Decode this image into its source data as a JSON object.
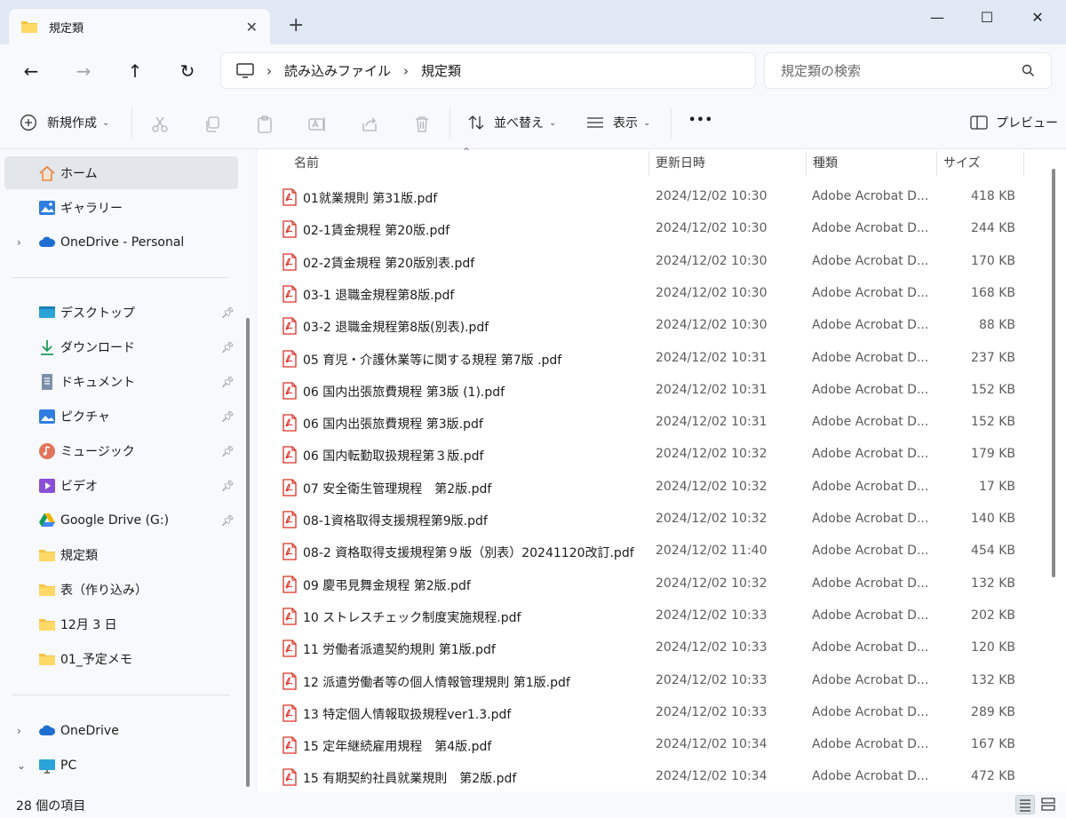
{
  "window": {
    "tab_title": "規定類",
    "close_tab": "✕",
    "new_tab": "+",
    "minimize": "—",
    "maximize": "☐",
    "close": "✕"
  },
  "nav": {
    "back": "←",
    "forward": "→",
    "up": "↑",
    "refresh": "↻",
    "breadcrumb": [
      "読み込みファイル",
      "規定類"
    ],
    "search_placeholder": "規定類の検索"
  },
  "toolbar": {
    "new_label": "新規作成",
    "sort_label": "並べ替え",
    "view_label": "表示",
    "more_label": "•••",
    "preview_label": "プレビュー"
  },
  "sidebar": {
    "top": [
      {
        "label": "ホーム",
        "icon": "home-icon",
        "selected": true
      },
      {
        "label": "ギャラリー",
        "icon": "gallery-icon"
      },
      {
        "label": "OneDrive - Personal",
        "icon": "cloud-icon",
        "expandable": true
      }
    ],
    "quick": [
      {
        "label": "デスクトップ",
        "icon": "desktop-icon",
        "pinned": true
      },
      {
        "label": "ダウンロード",
        "icon": "download-icon",
        "pinned": true
      },
      {
        "label": "ドキュメント",
        "icon": "document-icon",
        "pinned": true
      },
      {
        "label": "ピクチャ",
        "icon": "pictures-icon",
        "pinned": true
      },
      {
        "label": "ミュージック",
        "icon": "music-icon",
        "pinned": true
      },
      {
        "label": "ビデオ",
        "icon": "video-icon",
        "pinned": true
      },
      {
        "label": "Google Drive (G:)",
        "icon": "google-drive-icon",
        "pinned": true
      },
      {
        "label": "規定類",
        "icon": "folder-icon"
      },
      {
        "label": "表（作り込み）",
        "icon": "folder-icon"
      },
      {
        "label": "12月 3 日",
        "icon": "folder-icon"
      },
      {
        "label": "01_予定メモ",
        "icon": "folder-icon"
      }
    ],
    "bottom": [
      {
        "label": "OneDrive",
        "icon": "cloud-icon",
        "chevron": "›"
      },
      {
        "label": "PC",
        "icon": "pc-icon",
        "chevron": "⌄"
      }
    ]
  },
  "columns": {
    "name": "名前",
    "date": "更新日時",
    "type": "種類",
    "size": "サイズ"
  },
  "files": [
    {
      "name": "01就業規則 第31版.pdf",
      "date": "2024/12/02 10:30",
      "type": "Adobe Acrobat D...",
      "size": "418 KB"
    },
    {
      "name": "02-1賃金規程 第20版.pdf",
      "date": "2024/12/02 10:30",
      "type": "Adobe Acrobat D...",
      "size": "244 KB"
    },
    {
      "name": "02-2賃金規程 第20版別表.pdf",
      "date": "2024/12/02 10:30",
      "type": "Adobe Acrobat D...",
      "size": "170 KB"
    },
    {
      "name": "03-1 退職金規程第8版.pdf",
      "date": "2024/12/02 10:30",
      "type": "Adobe Acrobat D...",
      "size": "168 KB"
    },
    {
      "name": "03-2 退職金規程第8版(別表).pdf",
      "date": "2024/12/02 10:30",
      "type": "Adobe Acrobat D...",
      "size": "88 KB"
    },
    {
      "name": "05 育児・介護休業等に関する規程 第7版 .pdf",
      "date": "2024/12/02 10:31",
      "type": "Adobe Acrobat D...",
      "size": "237 KB"
    },
    {
      "name": "06 国内出張旅費規程 第3版 (1).pdf",
      "date": "2024/12/02 10:31",
      "type": "Adobe Acrobat D...",
      "size": "152 KB"
    },
    {
      "name": "06 国内出張旅費規程 第3版.pdf",
      "date": "2024/12/02 10:31",
      "type": "Adobe Acrobat D...",
      "size": "152 KB"
    },
    {
      "name": "06 国内転勤取扱規程第３版.pdf",
      "date": "2024/12/02 10:32",
      "type": "Adobe Acrobat D...",
      "size": "179 KB"
    },
    {
      "name": "07 安全衛生管理規程　第2版.pdf",
      "date": "2024/12/02 10:32",
      "type": "Adobe Acrobat D...",
      "size": "17 KB"
    },
    {
      "name": "08-1資格取得支援規程第9版.pdf",
      "date": "2024/12/02 10:32",
      "type": "Adobe Acrobat D...",
      "size": "140 KB"
    },
    {
      "name": "08-2 資格取得支援規程第９版（別表）20241120改訂.pdf",
      "date": "2024/12/02 11:40",
      "type": "Adobe Acrobat D...",
      "size": "454 KB"
    },
    {
      "name": "09 慶弔見舞金規程 第2版.pdf",
      "date": "2024/12/02 10:32",
      "type": "Adobe Acrobat D...",
      "size": "132 KB"
    },
    {
      "name": "10 ストレスチェック制度実施規程.pdf",
      "date": "2024/12/02 10:33",
      "type": "Adobe Acrobat D...",
      "size": "202 KB"
    },
    {
      "name": "11 労働者派遣契約規則 第1版.pdf",
      "date": "2024/12/02 10:33",
      "type": "Adobe Acrobat D...",
      "size": "120 KB"
    },
    {
      "name": "12 派遣労働者等の個人情報管理規則 第1版.pdf",
      "date": "2024/12/02 10:33",
      "type": "Adobe Acrobat D...",
      "size": "132 KB"
    },
    {
      "name": "13 特定個人情報取扱規程ver1.3.pdf",
      "date": "2024/12/02 10:33",
      "type": "Adobe Acrobat D...",
      "size": "289 KB"
    },
    {
      "name": "15 定年継続雇用規程　第4版.pdf",
      "date": "2024/12/02 10:34",
      "type": "Adobe Acrobat D...",
      "size": "167 KB"
    },
    {
      "name": "15 有期契約社員就業規則　第2版.pdf",
      "date": "2024/12/02 10:34",
      "type": "Adobe Acrobat D...",
      "size": "472 KB"
    }
  ],
  "status": {
    "count": "28 個の項目"
  }
}
